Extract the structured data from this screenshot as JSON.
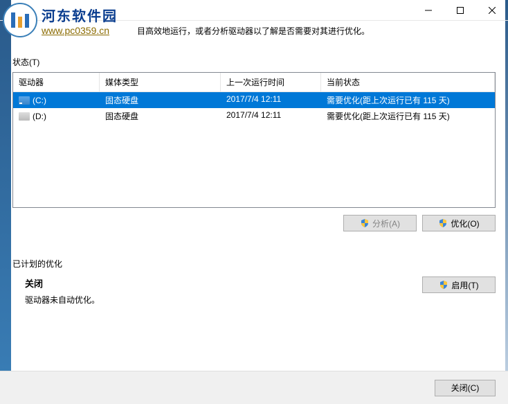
{
  "watermark": {
    "title": "河东软件园",
    "url": "www.pc0359.cn"
  },
  "description": "目高效地运行，或者分析驱动器以了解是否需要对其进行优化。",
  "status_label": "状态(T)",
  "columns": {
    "drive": "驱动器",
    "media": "媒体类型",
    "lastrun": "上一次运行时间",
    "status": "当前状态"
  },
  "drives": [
    {
      "name": "(C:)",
      "media": "固态硬盘",
      "lastrun": "2017/7/4 12:11",
      "status": "需要优化(距上次运行已有 115 天)",
      "selected": true,
      "icon": "c"
    },
    {
      "name": "(D:)",
      "media": "固态硬盘",
      "lastrun": "2017/7/4 12:11",
      "status": "需要优化(距上次运行已有 115 天)",
      "selected": false,
      "icon": "d"
    }
  ],
  "buttons": {
    "analyze": "分析(A)",
    "optimize": "优化(O)",
    "enable": "启用(T)",
    "close": "关闭(C)"
  },
  "scheduled": {
    "title": "已计划的优化",
    "status": "关闭",
    "desc": "驱动器未自动优化。"
  }
}
